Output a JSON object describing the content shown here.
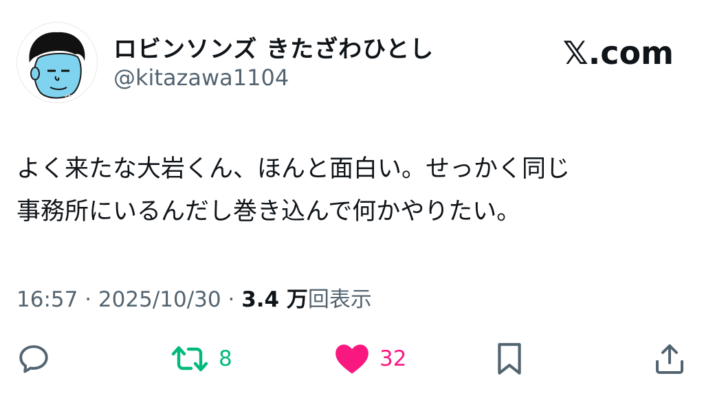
{
  "author": {
    "display_name": "ロビンソンズ きたざわひとし",
    "handle": "@kitazawa1104",
    "avatar_icon": "cartoon-face-avatar"
  },
  "brand": "𝕏.com",
  "tweet": {
    "lines": [
      "よく来たな大岩くん、ほんと面白い。せっかく同じ",
      "事務所にいるんだし巻き込んで何かやりたい。"
    ]
  },
  "meta": {
    "time": "16:57",
    "separator": "·",
    "date": "2025/10/30",
    "views_count": "3.4 万",
    "views_label": "回表示"
  },
  "actions": {
    "reply_icon": "reply-icon",
    "retweet_icon": "retweet-icon",
    "retweet_count": "8",
    "like_icon": "heart-icon",
    "like_count": "32",
    "bookmark_icon": "bookmark-icon",
    "share_icon": "share-icon",
    "retweet_color": "#00ba7c",
    "like_color": "#f91880",
    "text_color": "#0f1419",
    "secondary_color": "#536471"
  }
}
